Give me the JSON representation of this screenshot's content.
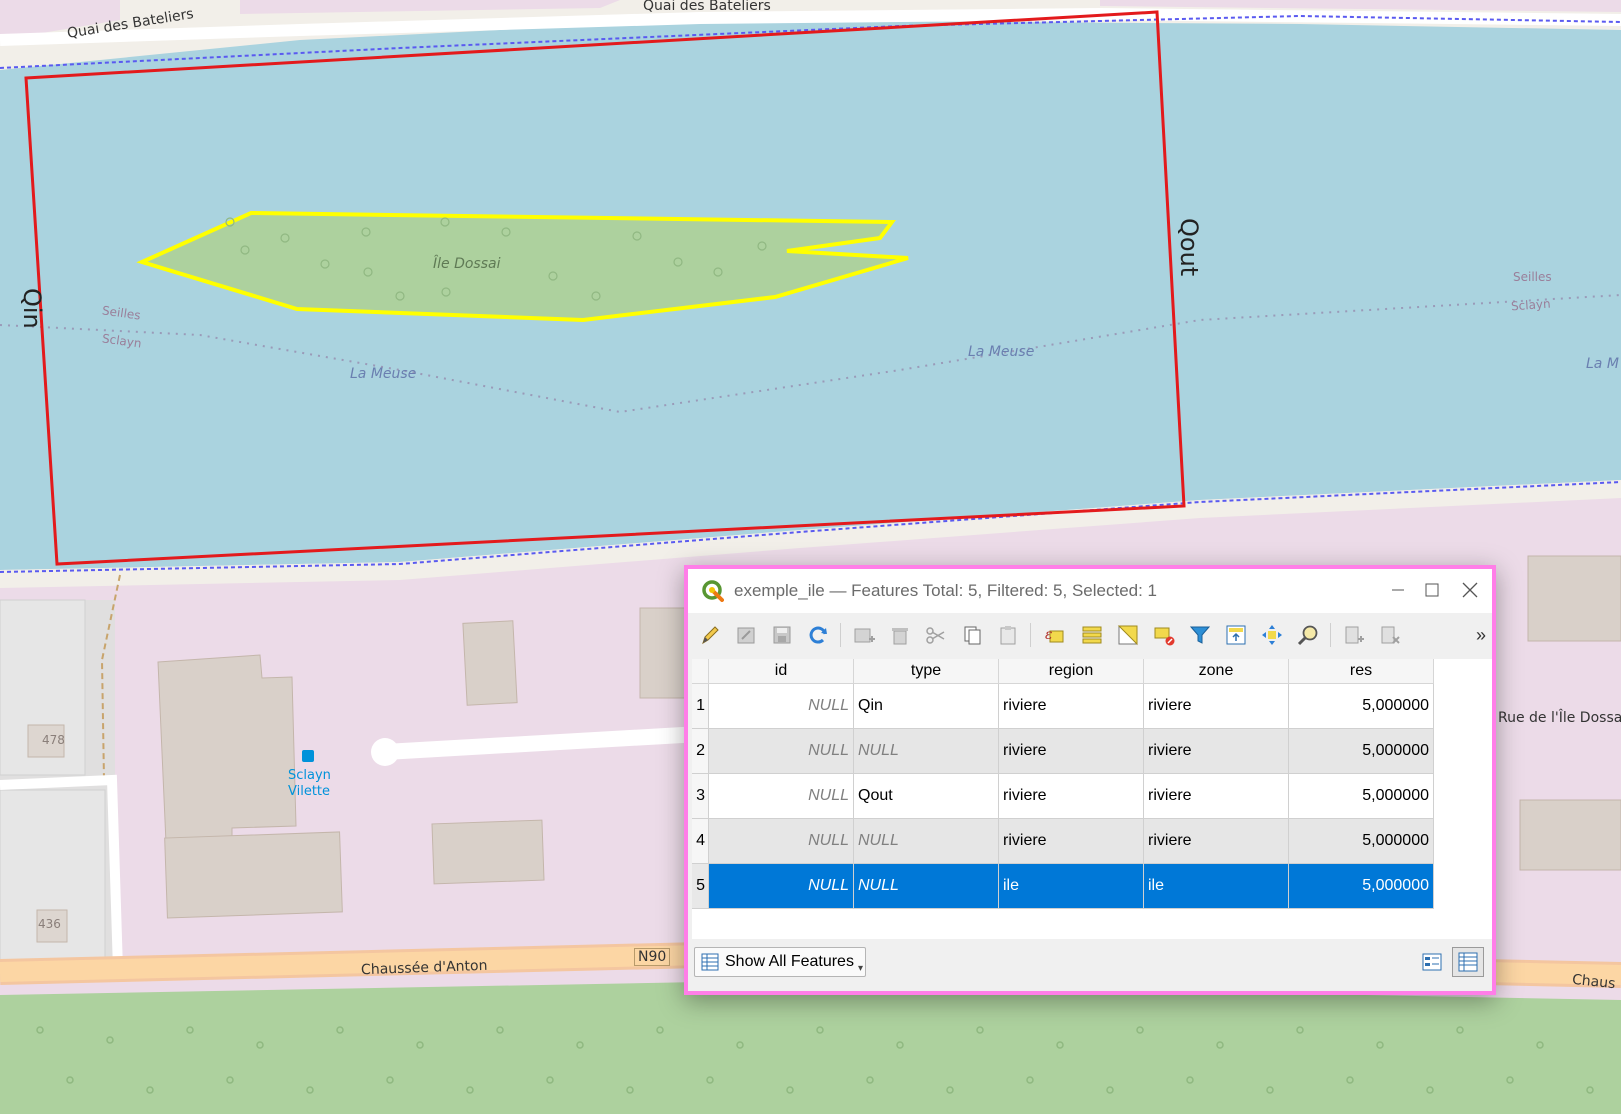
{
  "map": {
    "street_top_left": "Quai des Bateliers",
    "street_top_right": "Quai des Bateliers",
    "island_name": "Île Dossai",
    "label_qin": "Qin",
    "label_qout": "Qout",
    "river_name_left": "La Meuse",
    "river_name_right": "La Meuse",
    "river_name_edge": "La M",
    "boundary_a_left": "Seilles",
    "boundary_b_left": "Sclayn",
    "boundary_a_right": "Seilles",
    "boundary_b_right": "Sclayn",
    "bus_stop_name_1": "Sclayn",
    "bus_stop_name_2": "Vilette",
    "house_number_1": "478",
    "house_number_2": "436",
    "road_bottom": "Chaussée d'Anton",
    "road_ref": "N90",
    "road_right": "Rue de l'Île Dossa",
    "road_bottom_right": "Chaus",
    "colors": {
      "water": "#aad3df",
      "island": "#add19e",
      "residential": "#ecdbe8",
      "building": "#d9d0c9",
      "forest": "#add19e",
      "polygon_outline": "#e31a1c",
      "island_outline": "#ffff00",
      "window_highlight": "#ff7ee8"
    }
  },
  "window": {
    "title": "exemple_ile — Features Total: 5, Filtered: 5, Selected: 1",
    "app_icon": "qgis-icon",
    "min_icon": "minimize-icon",
    "max_icon": "maximize-icon",
    "close_icon": "close-icon"
  },
  "toolbar": {
    "icons": [
      "toggle-edit-icon",
      "multi-edit-icon",
      "save-edits-icon",
      "reload-icon",
      "add-feature-icon",
      "delete-feature-icon",
      "cut-icon",
      "copy-icon",
      "paste-icon",
      "expression-select-icon",
      "select-all-icon",
      "invert-selection-icon",
      "deselect-icon",
      "filter-icon",
      "move-selection-top-icon",
      "pan-to-selection-icon",
      "zoom-to-selection-icon",
      "new-field-icon",
      "delete-field-icon"
    ],
    "more_label": "»"
  },
  "table": {
    "columns": [
      "id",
      "type",
      "region",
      "zone",
      "res"
    ],
    "rows": [
      {
        "rownum": "1",
        "id": "NULL",
        "type": "Qin",
        "region": "riviere",
        "zone": "riviere",
        "res": "5,000000"
      },
      {
        "rownum": "2",
        "id": "NULL",
        "type": "NULL",
        "region": "riviere",
        "zone": "riviere",
        "res": "5,000000"
      },
      {
        "rownum": "3",
        "id": "NULL",
        "type": "Qout",
        "region": "riviere",
        "zone": "riviere",
        "res": "5,000000"
      },
      {
        "rownum": "4",
        "id": "NULL",
        "type": "NULL",
        "region": "riviere",
        "zone": "riviere",
        "res": "5,000000"
      },
      {
        "rownum": "5",
        "id": "NULL",
        "type": "NULL",
        "region": "ile",
        "zone": "ile",
        "res": "5,000000"
      }
    ],
    "selected_row": "5"
  },
  "statusbar": {
    "show_all_label": "Show All Features"
  }
}
